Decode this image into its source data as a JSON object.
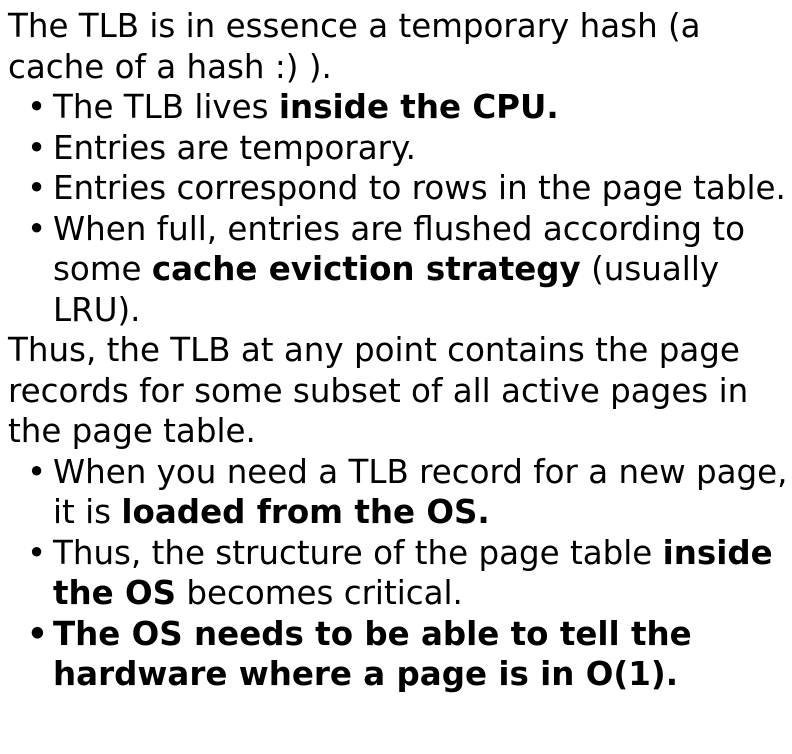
{
  "bullet_char": "•",
  "para1": "The TLB is in essence a temporary hash (a cache of a hash :) ).",
  "list1": {
    "item1": {
      "pre": "The TLB lives ",
      "bold": "inside the CPU."
    },
    "item2": {
      "text": "Entries are temporary."
    },
    "item3": {
      "text": "Entries correspond to rows in the page table."
    },
    "item4": {
      "pre": "When full, entries are flushed according to some ",
      "bold": "cache eviction strategy",
      "post": " (usually LRU)."
    }
  },
  "para2": "Thus, the TLB at any point contains the page records for some subset of all active pages in the page table.",
  "list2": {
    "item1": {
      "pre": "When you need a TLB record for a new page, it is ",
      "bold": "loaded from the OS."
    },
    "item2": {
      "pre": "Thus, the structure of the page table ",
      "bold": "inside the OS",
      "post": " becomes critical."
    },
    "item3": {
      "text": "The OS needs to be able to tell the hardware where a page is in O(1)."
    }
  }
}
